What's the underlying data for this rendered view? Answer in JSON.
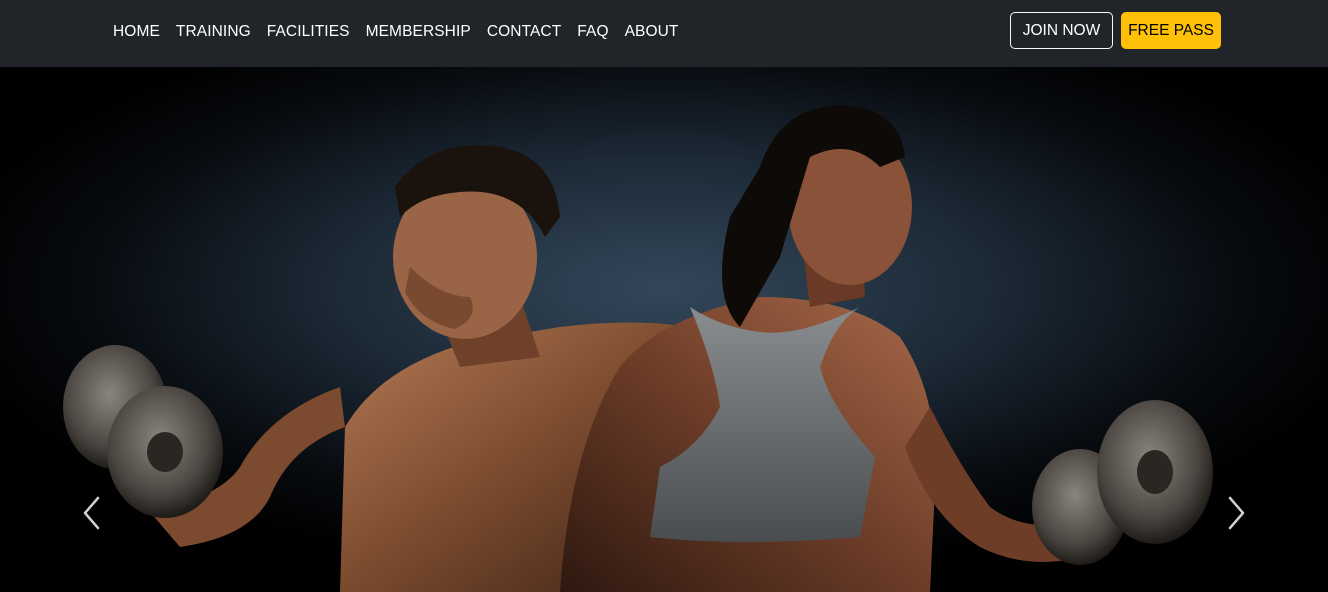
{
  "nav": {
    "links": [
      "HOME",
      "TRAINING",
      "FACILITIES",
      "MEMBERSHIP",
      "CONTACT",
      "FAQ",
      "ABOUT"
    ],
    "join_label": "JOIN NOW",
    "free_label": "FREE PASS"
  },
  "hero": {
    "image": "gym-couple-with-dumbbells",
    "prev_icon": "chevron-left-icon",
    "next_icon": "chevron-right-icon"
  },
  "colors": {
    "navbar_bg": "#212529",
    "accent": "#ffc107",
    "text": "#ffffff"
  }
}
